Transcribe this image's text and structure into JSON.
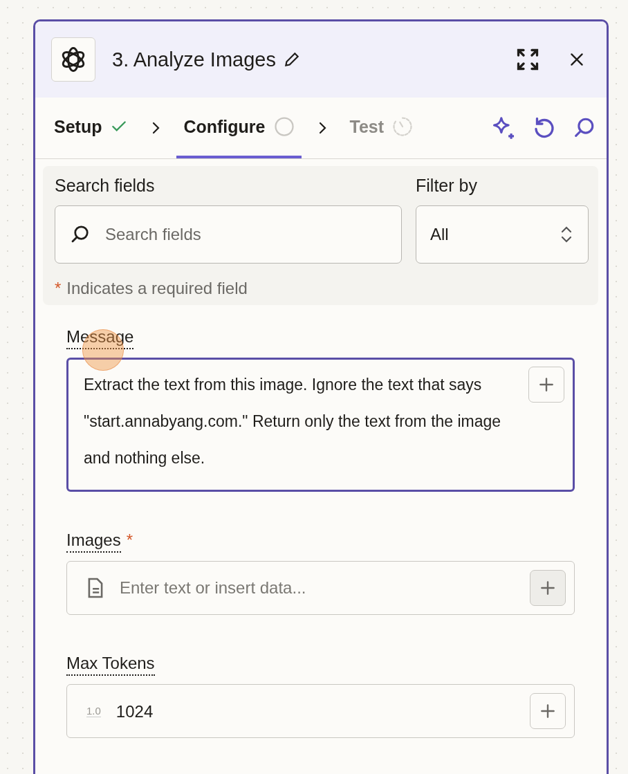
{
  "panel": {
    "step_title": "3. Analyze Images"
  },
  "steps": [
    {
      "label": "Setup",
      "kind": "done",
      "selected": false
    },
    {
      "label": "Configure",
      "kind": "pending",
      "selected": true
    },
    {
      "label": "Test",
      "kind": "waiting",
      "selected": false
    }
  ],
  "search": {
    "label": "Search fields",
    "placeholder": "Search fields"
  },
  "filter": {
    "label": "Filter by",
    "value": "All"
  },
  "required_note": {
    "mark": "*",
    "text": "Indicates a required field"
  },
  "fields": [
    {
      "kind": "textarea",
      "label": "Message",
      "required": false,
      "value": "Extract the text from this image. Ignore the text that says \"start.annabyang.com.\" Return only the text from the image and nothing else.",
      "focused": true
    },
    {
      "kind": "text",
      "label": "Images",
      "required": true,
      "placeholder": "Enter text or insert data...",
      "focused": false
    },
    {
      "kind": "number",
      "label": "Max Tokens",
      "required": false,
      "type_icon": "1.0",
      "value": "1024",
      "focused": false
    }
  ]
}
